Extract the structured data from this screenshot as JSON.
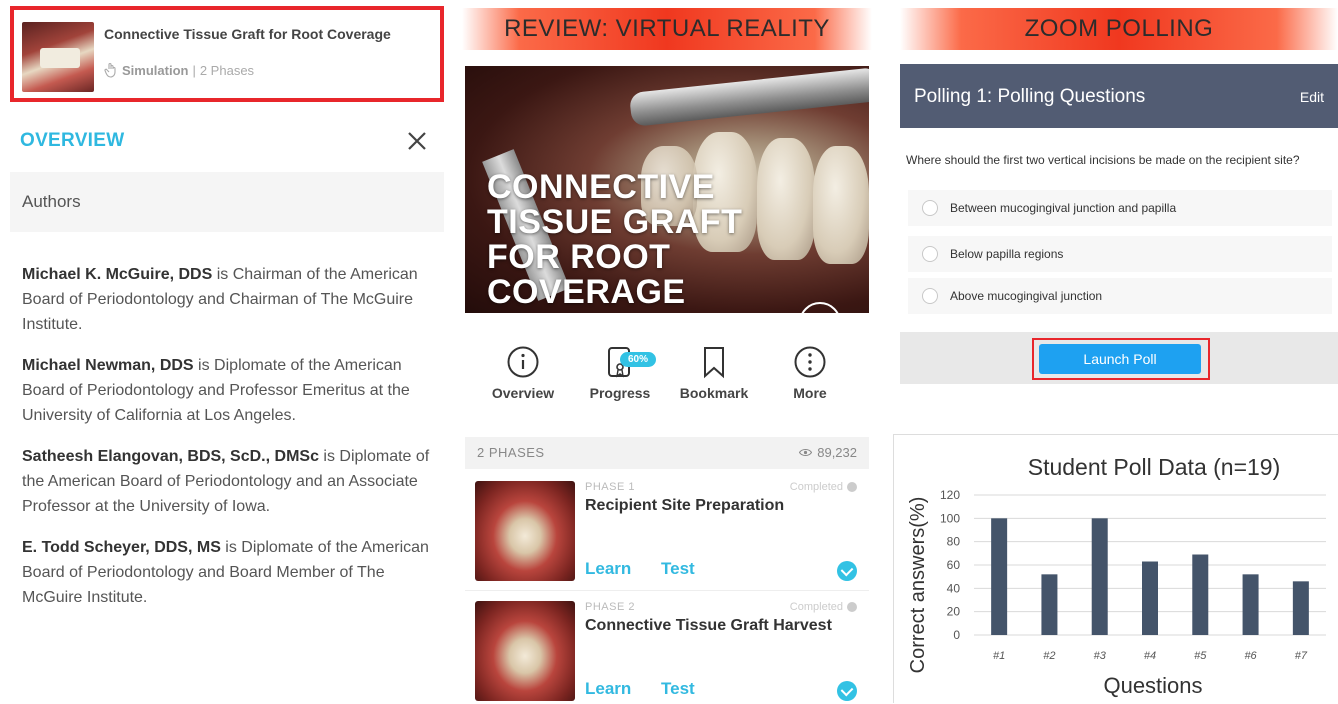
{
  "left_panel": {
    "course": {
      "title": "Connective Tissue Graft for Root Coverage",
      "kind": "Simulation",
      "separator": "|",
      "phases": "2 Phases"
    },
    "overview_title": "OVERVIEW",
    "authors_label": "Authors",
    "authors": [
      {
        "name": "Michael K. McGuire, DDS",
        "bio": " is Chairman of the American Board of Periodontology and Chairman of The McGuire Institute."
      },
      {
        "name": "Michael Newman, DDS",
        "bio": " is Diplomate of the American Board of Periodontology and Professor Emeritus at the University of California at Los Angeles."
      },
      {
        "name": "Satheesh Elangovan, BDS, ScD., DMSc",
        "bio": " is Diplomate of the American Board of Periodontology and an Associate Professor at the University of Iowa."
      },
      {
        "name": "E. Todd Scheyer, DDS, MS",
        "bio": " is Diplomate of the American Board of Periodontology and Board Member of The McGuire Institute."
      }
    ],
    "colors": {
      "accent": "#2fb8e0",
      "highlight_border": "#e8262b"
    }
  },
  "banners": {
    "vr": "REVIEW: VIRTUAL REALITY",
    "zoom": "ZOOM POLLING"
  },
  "middle_panel": {
    "hero_text": "CONNECTIVE\nTISSUE GRAFT\nFOR ROOT\nCOVERAGE",
    "actions": [
      {
        "label": "Overview",
        "icon": "info-icon"
      },
      {
        "label": "Progress",
        "icon": "progress-icon"
      },
      {
        "label": "Bookmark",
        "icon": "bookmark-icon"
      },
      {
        "label": "More",
        "icon": "more-icon"
      }
    ],
    "progress_badge": "60%",
    "phases_count": "2 PHASES",
    "views": "89,232",
    "phases": [
      {
        "num": "PHASE 1",
        "status": "Completed",
        "name": "Recipient Site Preparation",
        "learn": "Learn",
        "test": "Test"
      },
      {
        "num": "PHASE 2",
        "status": "Completed",
        "name": "Connective Tissue Graft Harvest",
        "learn": "Learn",
        "test": "Test"
      }
    ]
  },
  "right_panel": {
    "poll": {
      "title": "Polling 1: Polling Questions",
      "edit": "Edit",
      "question": "Where should the first two vertical incisions be made on the recipient site?",
      "options": [
        "Between mucogingival junction and papilla",
        "Below papilla regions",
        "Above mucogingival junction"
      ],
      "launch_button": "Launch Poll",
      "header_color": "#525c73",
      "button_color": "#1ea1f1"
    },
    "chart_data": {
      "type": "bar",
      "title": "Student Poll Data (n=19)",
      "xlabel": "Questions",
      "ylabel": "Correct answers(%)",
      "categories": [
        "#1",
        "#2",
        "#3",
        "#4",
        "#5",
        "#6",
        "#7"
      ],
      "values": [
        100,
        52,
        100,
        63,
        69,
        52,
        46
      ],
      "ylim": [
        0,
        120
      ],
      "yticks": [
        0,
        20,
        40,
        60,
        80,
        100,
        120
      ],
      "bar_color": "#44546a",
      "grid": true
    }
  }
}
